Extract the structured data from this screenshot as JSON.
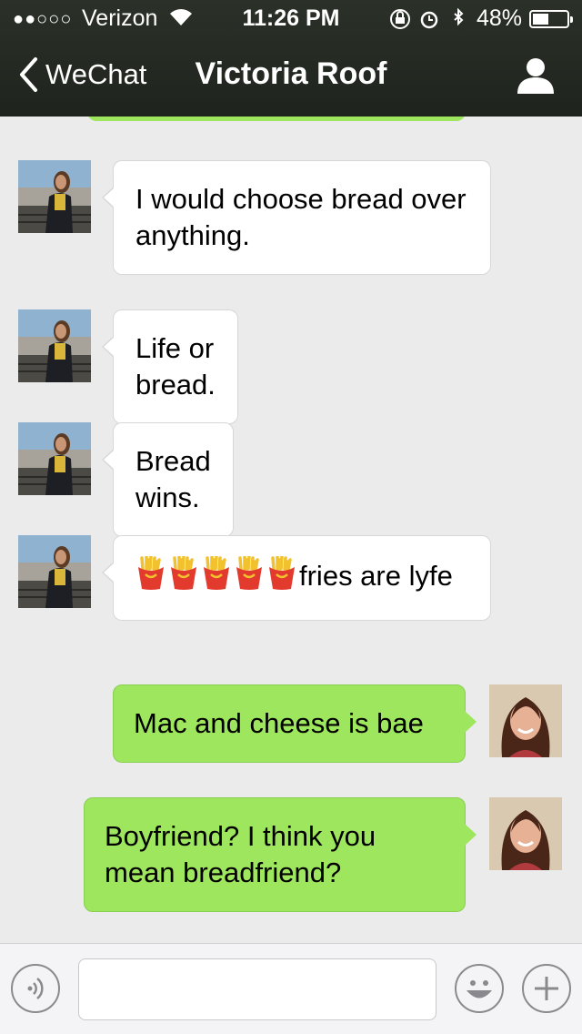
{
  "status_bar": {
    "carrier": "Verizon",
    "signal_dots": "●●○○○",
    "time": "11:26 PM",
    "battery_percent": "48%",
    "battery_level": 0.48
  },
  "nav": {
    "back_label": "WeChat",
    "title": "Victoria Roof"
  },
  "messages": [
    {
      "side": "incoming",
      "text": "I would choose bread over anything."
    },
    {
      "side": "incoming",
      "text": "Life or bread."
    },
    {
      "side": "incoming",
      "text": "Bread wins."
    },
    {
      "side": "incoming",
      "fries_count": 5,
      "text": "fries are lyfe"
    },
    {
      "side": "outgoing",
      "text": "Mac and cheese is bae"
    },
    {
      "side": "outgoing",
      "text": "Boyfriend? I think you mean breadfriend?"
    }
  ],
  "input": {
    "value": "",
    "placeholder": ""
  },
  "colors": {
    "outgoing_bubble": "#9ee65d",
    "incoming_bubble": "#ffffff",
    "background": "#ebebeb",
    "navbar": "#23281f"
  }
}
